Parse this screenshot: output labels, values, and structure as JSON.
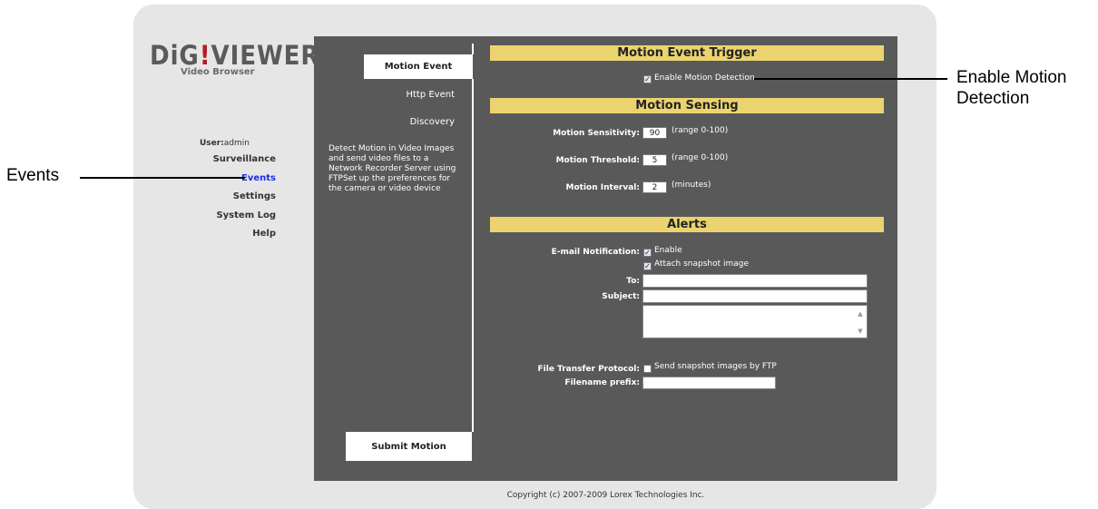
{
  "logo": {
    "part1": "DiG",
    "part2": "!",
    "part3": "VIEWER",
    "subtitle": "Video Browser"
  },
  "user": {
    "label": "User:",
    "name": "admin"
  },
  "nav": {
    "items": [
      "Surveillance",
      "Events",
      "Settings",
      "System Log",
      "Help"
    ],
    "active": "Events"
  },
  "tabs": {
    "active": "Motion Event",
    "others": [
      "Http Event",
      "Discovery"
    ]
  },
  "description": "Detect Motion in Video Images and send video files to a Network Recorder Server using FTPSet up the preferences for the camera or video device",
  "submit_label": "Submit Motion",
  "trigger": {
    "header": "Motion Event Trigger",
    "enable_label": "Enable Motion Detection",
    "enable_checked": true
  },
  "sensing": {
    "header": "Motion Sensing",
    "sensitivity_label": "Motion Sensitivity:",
    "sensitivity_value": "90",
    "sensitivity_hint": "(range 0-100)",
    "threshold_label": "Motion Threshold:",
    "threshold_value": "5",
    "threshold_hint": "(range 0-100)",
    "interval_label": "Motion Interval:",
    "interval_value": "2",
    "interval_hint": "(minutes)"
  },
  "alerts": {
    "header": "Alerts",
    "email_label": "E-mail Notification:",
    "enable_label": "Enable",
    "enable_checked": true,
    "attach_label": "Attach snapshot image",
    "attach_checked": true,
    "to_label": "To:",
    "to_value": "",
    "subject_label": "Subject:",
    "subject_value": "",
    "body_value": "",
    "ftp_label": "File Transfer Protocol:",
    "ftp_option_label": "Send snapshot images by FTP",
    "ftp_checked": false,
    "prefix_label": "Filename prefix:",
    "prefix_value": ""
  },
  "footer": "Copyright (c) 2007-2009 Lorex Technologies Inc.",
  "annotations": {
    "left": "Events",
    "right_line1": "Enable Motion",
    "right_line2": "Detection"
  },
  "colors": {
    "panel_bg": "#595959",
    "header_bg": "#ebd470",
    "frame_bg": "#e6e6e6",
    "logo_red": "#b21f24",
    "active_nav": "#1f2ee0"
  }
}
